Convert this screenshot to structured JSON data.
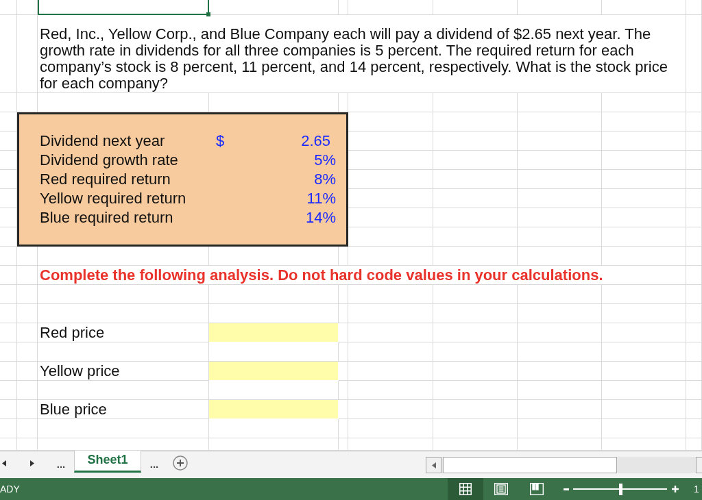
{
  "sheet": {
    "active_cell": {
      "selected": true
    },
    "question": "Red, Inc., Yellow Corp., and Blue Company each will pay a dividend of $2.65 next year. The growth rate in dividends for all three companies is 5 percent. The required return for each company’s stock is 8 percent, 11 percent, and 14 percent, respectively. What is the stock price for each company?",
    "inputs": [
      {
        "label": "Dividend next year",
        "currency": "$",
        "value": "2.65"
      },
      {
        "label": "Dividend growth rate",
        "value": "5%"
      },
      {
        "label": "Red required return",
        "value": "8%"
      },
      {
        "label": "Yellow required return",
        "value": "11%"
      },
      {
        "label": "Blue required return",
        "value": "14%"
      }
    ],
    "instruction": "Complete the following analysis. Do not hard code values in your calculations.",
    "answers": [
      {
        "label": "Red price"
      },
      {
        "label": "Yellow price"
      },
      {
        "label": "Blue price"
      }
    ]
  },
  "sheet_tabs": {
    "more_before": "...",
    "tabs": [
      {
        "label": "Sheet1",
        "selected": true
      }
    ],
    "more_after": "..."
  },
  "status_bar": {
    "status": "ADY",
    "views": [
      {
        "kind": "normal",
        "selected": true
      },
      {
        "kind": "page_layout",
        "selected": false
      },
      {
        "kind": "page_break_preview",
        "selected": false
      }
    ],
    "zoom": {
      "level": 0.5,
      "reading": "1"
    }
  }
}
